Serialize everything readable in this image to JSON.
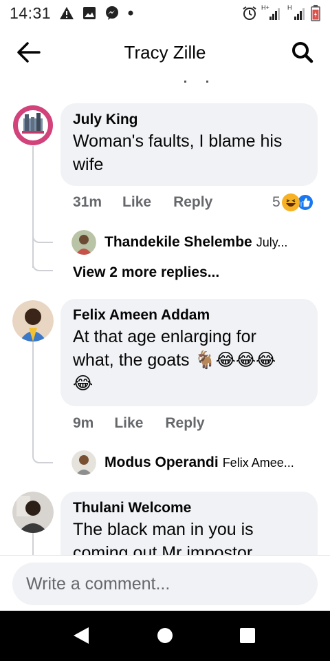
{
  "status_bar": {
    "time": "14:31",
    "icons_left": [
      "warning-icon",
      "image-icon",
      "messenger-icon",
      "dot-icon"
    ],
    "icons_right": [
      "alarm-icon",
      "signal-hplus-icon",
      "signal-h-icon",
      "battery-icon"
    ],
    "network_label_1": "H+",
    "network_label_2": "H"
  },
  "header": {
    "title": "Tracy Zille"
  },
  "comments": [
    {
      "name": "July King",
      "text_line1": "Woman's faults, I blame his",
      "text_line2": "wife",
      "time": "31m",
      "like_label": "Like",
      "reply_label": "Reply",
      "reaction_count": "5",
      "reactions": [
        "haha-icon",
        "like-icon"
      ],
      "replies": [
        {
          "name": "Thandekile Shelembe",
          "snippet": "July..."
        }
      ],
      "more_replies": "View 2 more replies..."
    },
    {
      "name": "Felix Ameen Addam",
      "text_line1": "At that age enlarging for",
      "text_line2": "what, the goats 🐐😂😂😂",
      "text_line3": "😂",
      "time": "9m",
      "like_label": "Like",
      "reply_label": "Reply",
      "replies": [
        {
          "name": "Modus Operandi",
          "snippet": "Felix Amee..."
        }
      ]
    },
    {
      "name": "Thulani Welcome",
      "text_line1": "The black man in you is",
      "text_line2": "coming out Mr impostor"
    }
  ],
  "input": {
    "placeholder": "Write a comment..."
  },
  "colors": {
    "bubble_bg": "#f0f2f5",
    "secondary_text": "#65676b",
    "like_blue": "#1877f2",
    "haha_yellow": "#f7b125"
  }
}
